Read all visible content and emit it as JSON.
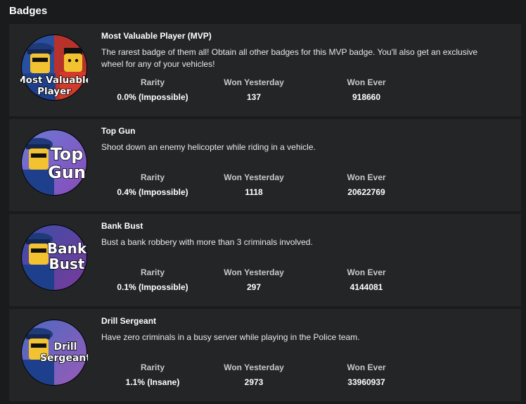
{
  "section_title": "Badges",
  "colors": {
    "page_bg": "#191b1d",
    "card_bg": "#232527",
    "label_text": "#c8c8c8",
    "value_text": "#ffffff"
  },
  "stat_labels": {
    "rarity": "Rarity",
    "won_yesterday": "Won Yesterday",
    "won_ever": "Won Ever"
  },
  "badges": [
    {
      "name": "Most Valuable Player (MVP)",
      "description": "The rarest badge of them all! Obtain all other badges for this MVP badge. You'll also get an exclusive wheel for any of your vehicles!",
      "rarity": "0.0% (Impossible)",
      "won_yesterday": "137",
      "won_ever": "918660",
      "icon": {
        "name": "mvp-badge-icon",
        "lines": [
          "Most Valuable",
          "Player"
        ]
      }
    },
    {
      "name": "Top Gun",
      "description": "Shoot down an enemy helicopter while riding in a vehicle.",
      "rarity": "0.4% (Impossible)",
      "won_yesterday": "1118",
      "won_ever": "20622769",
      "icon": {
        "name": "top-gun-badge-icon",
        "lines": [
          "Top",
          "Gun"
        ]
      }
    },
    {
      "name": "Bank Bust",
      "description": "Bust a bank robbery with more than 3 criminals involved.",
      "rarity": "0.1% (Impossible)",
      "won_yesterday": "297",
      "won_ever": "4144081",
      "icon": {
        "name": "bank-bust-badge-icon",
        "lines": [
          "Bank",
          "Bust"
        ]
      }
    },
    {
      "name": "Drill Sergeant",
      "description": "Have zero criminals in a busy server while playing in the Police team.",
      "rarity": "1.1% (Insane)",
      "won_yesterday": "2973",
      "won_ever": "33960937",
      "icon": {
        "name": "drill-sergeant-badge-icon",
        "lines": [
          "Drill",
          "Sergeant"
        ]
      }
    }
  ]
}
